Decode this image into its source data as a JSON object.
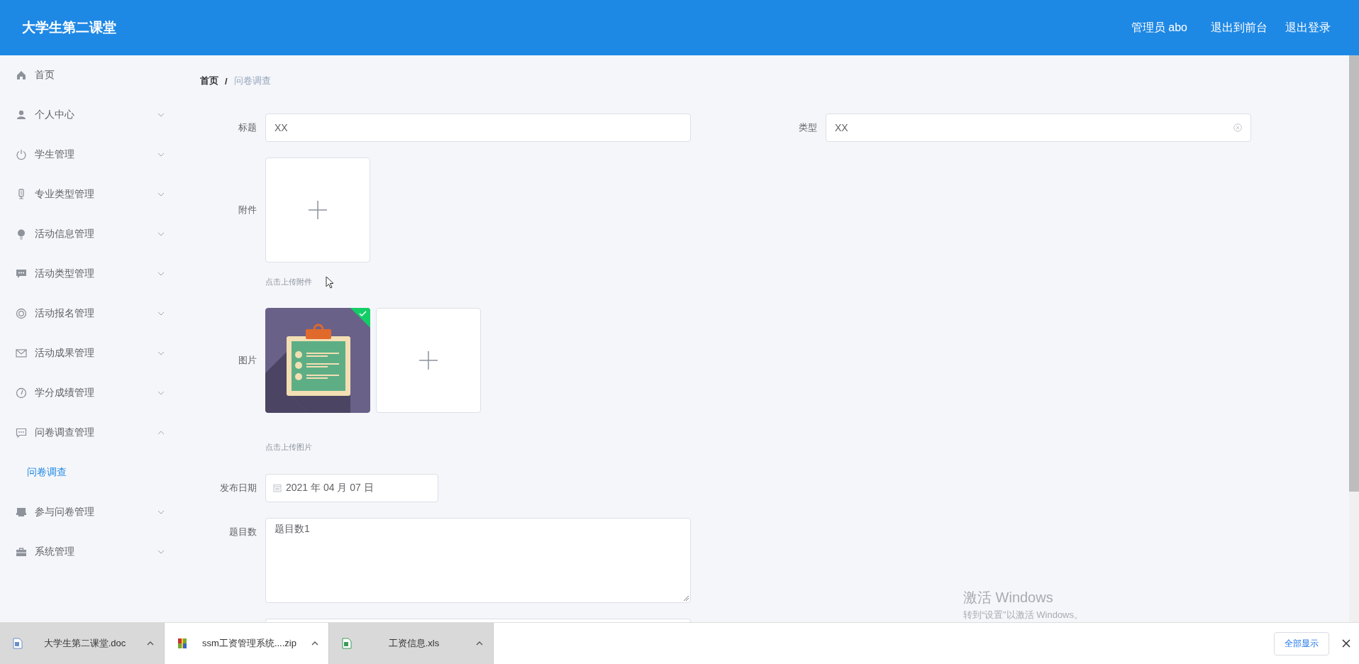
{
  "header": {
    "title": "大学生第二课堂",
    "user": "管理员 abo",
    "links": [
      "退出到前台",
      "退出登录"
    ]
  },
  "sidebar": {
    "items": [
      {
        "label": "首页",
        "kind": "link"
      },
      {
        "label": "个人中心",
        "kind": "menu",
        "expanded": false
      },
      {
        "label": "学生管理",
        "kind": "menu",
        "expanded": false
      },
      {
        "label": "专业类型管理",
        "kind": "menu",
        "expanded": false
      },
      {
        "label": "活动信息管理",
        "kind": "menu",
        "expanded": false
      },
      {
        "label": "活动类型管理",
        "kind": "menu",
        "expanded": false
      },
      {
        "label": "活动报名管理",
        "kind": "menu",
        "expanded": false
      },
      {
        "label": "活动成果管理",
        "kind": "menu",
        "expanded": false
      },
      {
        "label": "学分成绩管理",
        "kind": "menu",
        "expanded": false
      },
      {
        "label": "问卷调查管理",
        "kind": "menu",
        "expanded": true,
        "children": [
          {
            "label": "问卷调查",
            "selected": true
          }
        ]
      },
      {
        "label": "参与问卷管理",
        "kind": "menu",
        "expanded": false
      },
      {
        "label": "系统管理",
        "kind": "menu",
        "expanded": false
      }
    ]
  },
  "breadcrumb": {
    "items": [
      "首页",
      "问卷调查"
    ],
    "separator": "/"
  },
  "form": {
    "fields": [
      {
        "kind": "text",
        "label": "标题",
        "value": "XX"
      },
      {
        "kind": "select",
        "label": "类型",
        "value": "XX"
      },
      {
        "kind": "upload",
        "label": "附件",
        "hint": "点击上传附件"
      },
      {
        "kind": "image-upload",
        "label": "图片",
        "hint": "点击上传图片",
        "uploaded": true
      },
      {
        "kind": "date",
        "label": "发布日期",
        "value": "2021 年 04 月 07 日"
      },
      {
        "kind": "textarea",
        "label": "题目数",
        "value": "题目数1"
      },
      {
        "kind": "input"
      }
    ]
  },
  "watermark": {
    "title": "激活 Windows",
    "subtitle": "转到“设置”以激活 Windows。"
  },
  "downloads": {
    "items": [
      {
        "name": "大学生第二课堂.doc",
        "kind": "doc",
        "hovered": true
      },
      {
        "name": "ssm工资管理系统....zip",
        "kind": "zip",
        "hovered": false
      },
      {
        "name": "工资信息.xls",
        "kind": "xls",
        "hovered": true
      }
    ],
    "show_all": "全部显示"
  }
}
